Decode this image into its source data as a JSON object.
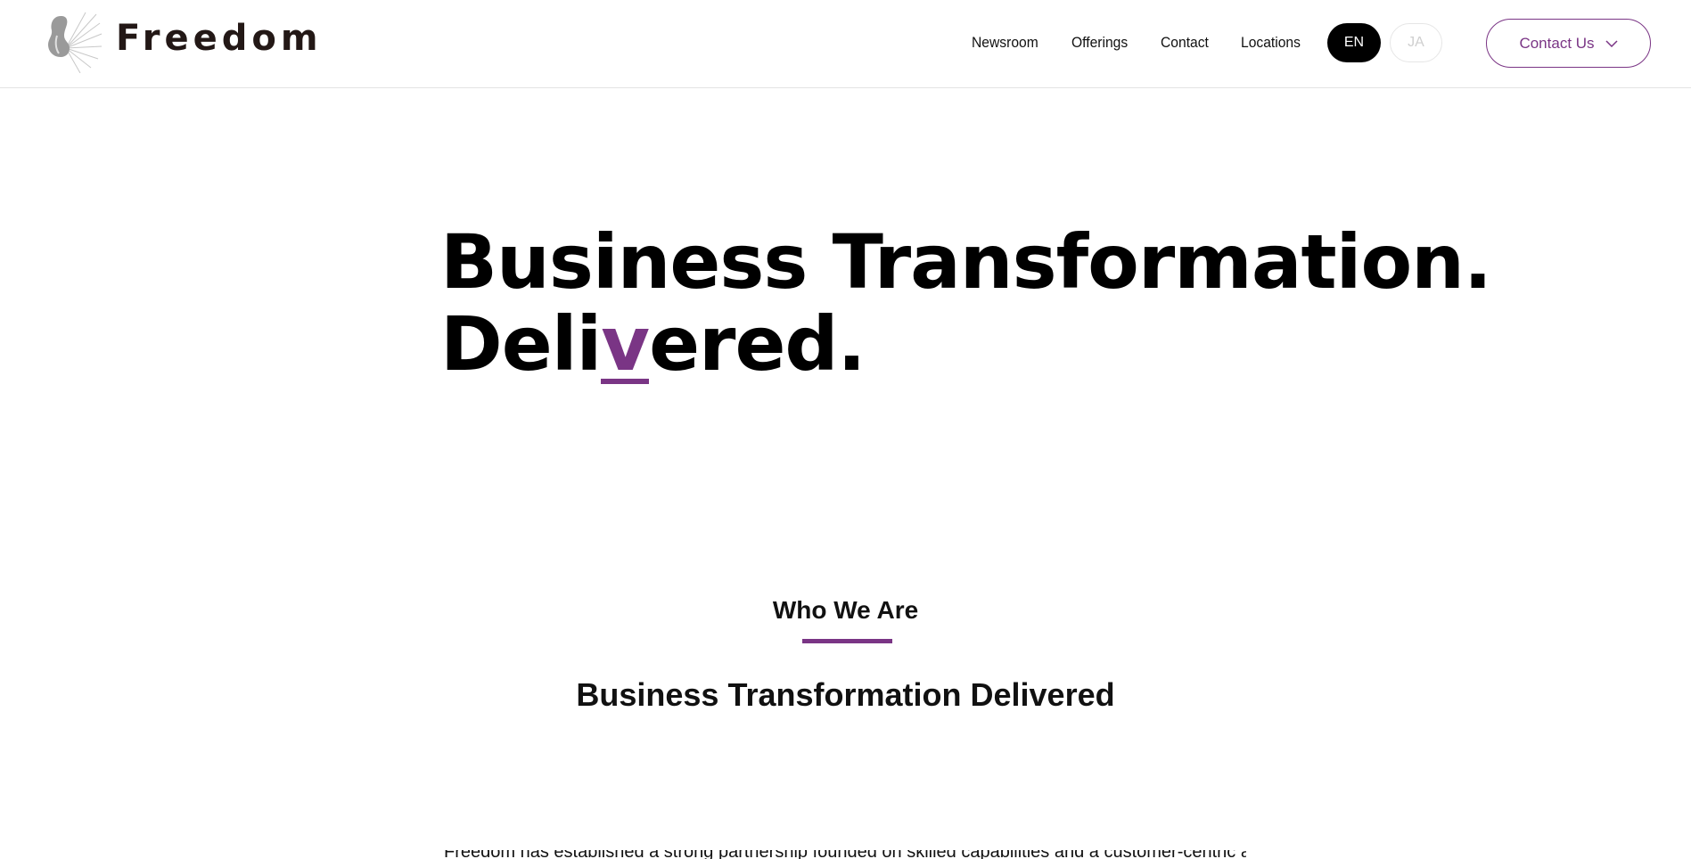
{
  "header": {
    "logo_text": "Freedom",
    "nav": [
      {
        "label": "Newsroom"
      },
      {
        "label": "Offerings"
      },
      {
        "label": "Contact"
      },
      {
        "label": "Locations"
      }
    ],
    "languages": {
      "active": "EN",
      "inactive": "JA"
    },
    "contact_button": {
      "label": "Contact Us",
      "icon": "chevron-down-icon"
    }
  },
  "hero": {
    "line1": "Business Transformation.",
    "line2_start": "Deli",
    "line2_accent": "v",
    "line2_end": "ered."
  },
  "who_we_are": {
    "label": "Who We Are",
    "title": "Business Transformation Delivered",
    "body_peek": "Freedom has established a strong partnership founded on skilled capabilities and a customer-centric approach"
  },
  "colors": {
    "accent": "#7a3585",
    "text": "#000000",
    "logo_text": "#231816"
  }
}
